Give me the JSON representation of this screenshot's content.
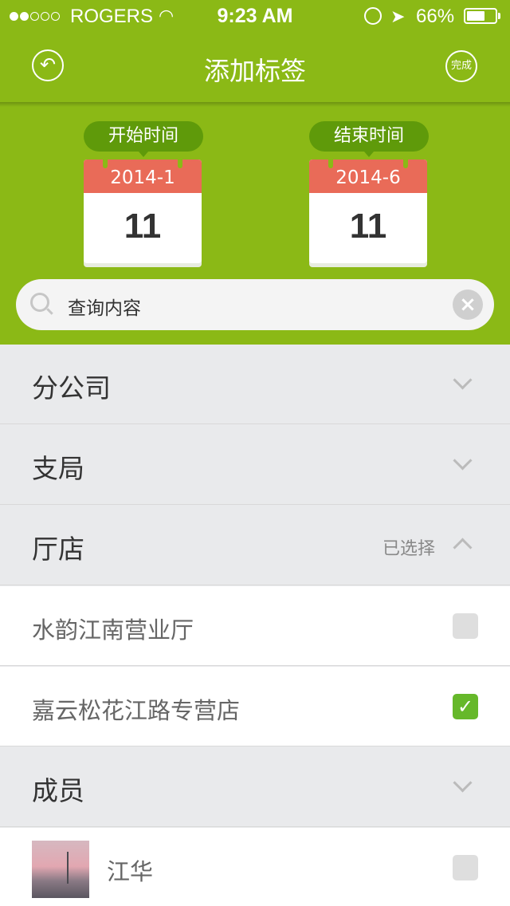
{
  "status_bar": {
    "carrier": "ROGERS",
    "time": "9:23 AM",
    "battery": "66%",
    "battery_level": 0.66,
    "signal_bars": 2,
    "icons": [
      "wifi-icon",
      "rotation-lock-icon",
      "location-arrow-icon",
      "battery-icon"
    ]
  },
  "navbar": {
    "title": "添加标签",
    "done_label": "完成",
    "back_icon": "reply-arrow-icon"
  },
  "date_range": {
    "start": {
      "label": "开始时间",
      "month": "2014-1",
      "day": "11"
    },
    "end": {
      "label": "结束时间",
      "month": "2014-6",
      "day": "11"
    }
  },
  "search": {
    "placeholder": "查询内容",
    "icon": "search-icon",
    "clear_icon": "clear-icon"
  },
  "sections": {
    "branch": {
      "label": "分公司"
    },
    "bureau": {
      "label": "支局"
    },
    "store": {
      "label": "厅店",
      "selected_text": "已选择",
      "items": [
        {
          "label": "水韵江南营业厅",
          "checked": false
        },
        {
          "label": "嘉云松花江路专营店",
          "checked": true
        }
      ]
    },
    "members": {
      "label": "成员",
      "items": [
        {
          "label": "江华",
          "checked": false
        }
      ]
    }
  },
  "colors": {
    "brand_green": "#8bb916",
    "calendar_red": "#e96b58",
    "check_green": "#66b82a"
  }
}
